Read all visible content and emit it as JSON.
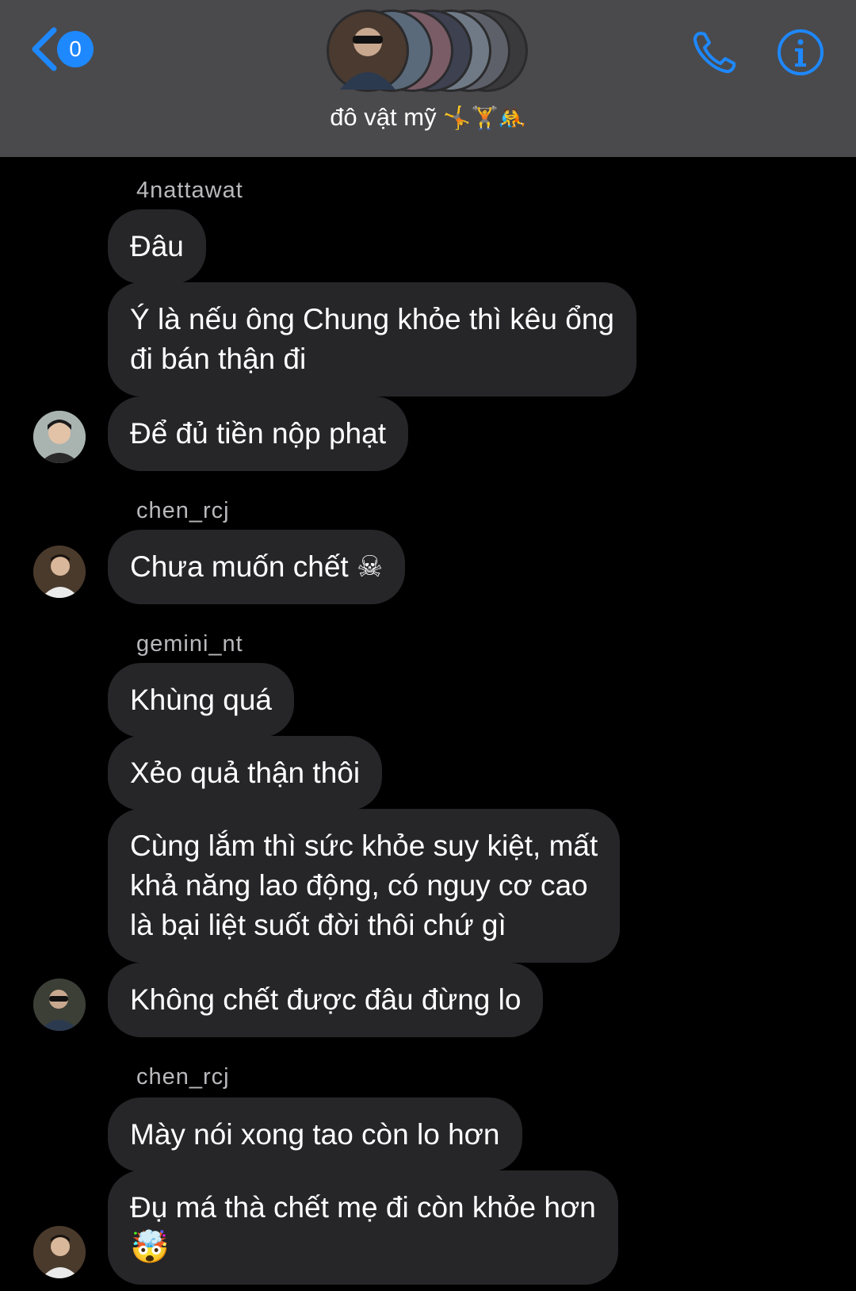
{
  "header": {
    "back_badge": "0",
    "title": "đô vật mỹ",
    "title_emoji": "🤸🏋🤼",
    "call_icon": "phone-icon",
    "info_icon": "info-icon"
  },
  "messages": [
    {
      "sender": "4nattawat"
    },
    {
      "text": "Đâu"
    },
    {
      "text": "Ý là nếu ông Chung khỏe thì kêu ổng",
      "text2": "đi bán thận đi"
    },
    {
      "text": "Để đủ tiền nộp phạt"
    },
    {
      "sender": "chen_rcj"
    },
    {
      "text": "Chưa muốn chết ",
      "emoji": "☠"
    },
    {
      "sender": "gemini_nt"
    },
    {
      "text": "Khùng quá"
    },
    {
      "text": "Xẻo quả thận thôi"
    },
    {
      "text": "Cùng lắm thì sức khỏe suy kiệt, mất",
      "text2": "khả năng lao động, có nguy cơ cao",
      "text3": "là bại liệt suốt đời thôi chứ gì"
    },
    {
      "text": "Không chết được đâu đừng lo"
    },
    {
      "sender": "chen_rcj"
    },
    {
      "text": "Mày nói xong tao còn lo hơn"
    },
    {
      "text": "Đụ má thà chết mẹ đi còn khỏe hơn",
      "emoji": "🤯"
    }
  ],
  "colors": {
    "header_bg": "#4a4a4c",
    "bubble_bg": "#262629",
    "accent": "#1e88ff",
    "sender_text": "#b9b9bd"
  }
}
